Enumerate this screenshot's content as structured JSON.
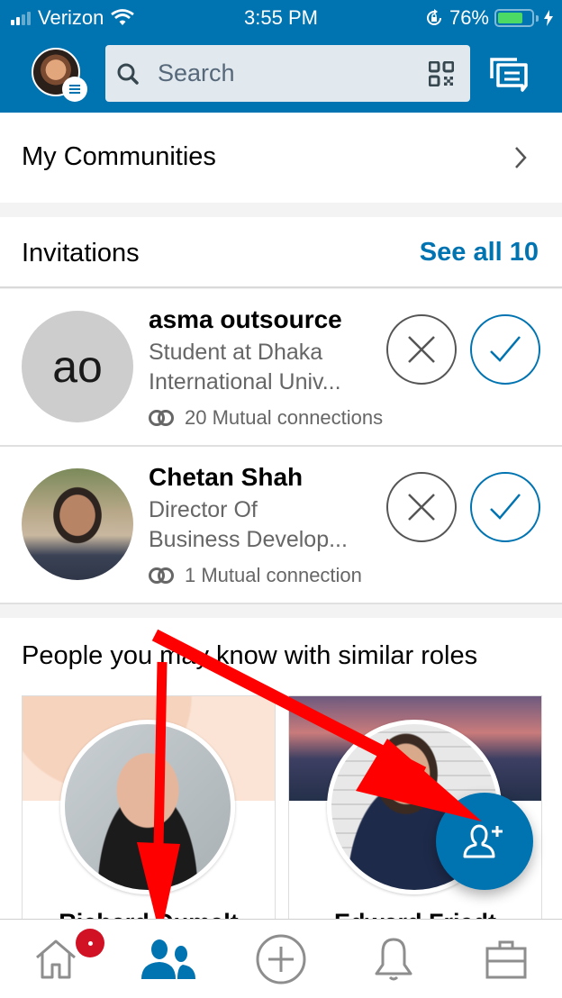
{
  "status_bar": {
    "carrier": "Verizon",
    "time": "3:55 PM",
    "battery_percent": "76%",
    "battery_level": 0.76,
    "icons": [
      "signal-icon",
      "wifi-icon",
      "rotation-lock-icon",
      "battery-icon",
      "charging-icon"
    ]
  },
  "header": {
    "search_placeholder": "Search",
    "icons": [
      "avatar",
      "menu-icon",
      "search-icon",
      "qr-code-icon",
      "messaging-icon"
    ]
  },
  "communities": {
    "label": "My Communities"
  },
  "invitations": {
    "label": "Invitations",
    "see_all": "See all 10",
    "items": [
      {
        "initials": "ao",
        "name": "asma outsource",
        "headline_line1": "Student at Dhaka",
        "headline_line2": "International Univ...",
        "mutual": "20 Mutual connections"
      },
      {
        "initials": "",
        "name": "Chetan Shah",
        "headline_line1": "Director Of",
        "headline_line2": "Business Develop...",
        "mutual": "1 Mutual connection"
      }
    ]
  },
  "pymk": {
    "title": "People you may know with similar roles",
    "cards": [
      {
        "name": "Richard Dumalt"
      },
      {
        "name": "Edward Friedt"
      }
    ]
  },
  "fab": {
    "icon": "add-connection-icon"
  },
  "tabbar": {
    "items": [
      {
        "name": "home",
        "icon": "home-icon",
        "has_badge": true,
        "active": false
      },
      {
        "name": "my-network",
        "icon": "people-icon",
        "active": true
      },
      {
        "name": "post",
        "icon": "plus-circle-icon",
        "active": false
      },
      {
        "name": "notifications",
        "icon": "bell-icon",
        "active": false
      },
      {
        "name": "jobs",
        "icon": "briefcase-icon",
        "active": false
      }
    ]
  },
  "colors": {
    "brand": "#0073b1",
    "badge": "#d11124",
    "annotation_arrow": "#ff0000",
    "battery": "#4cd964"
  }
}
